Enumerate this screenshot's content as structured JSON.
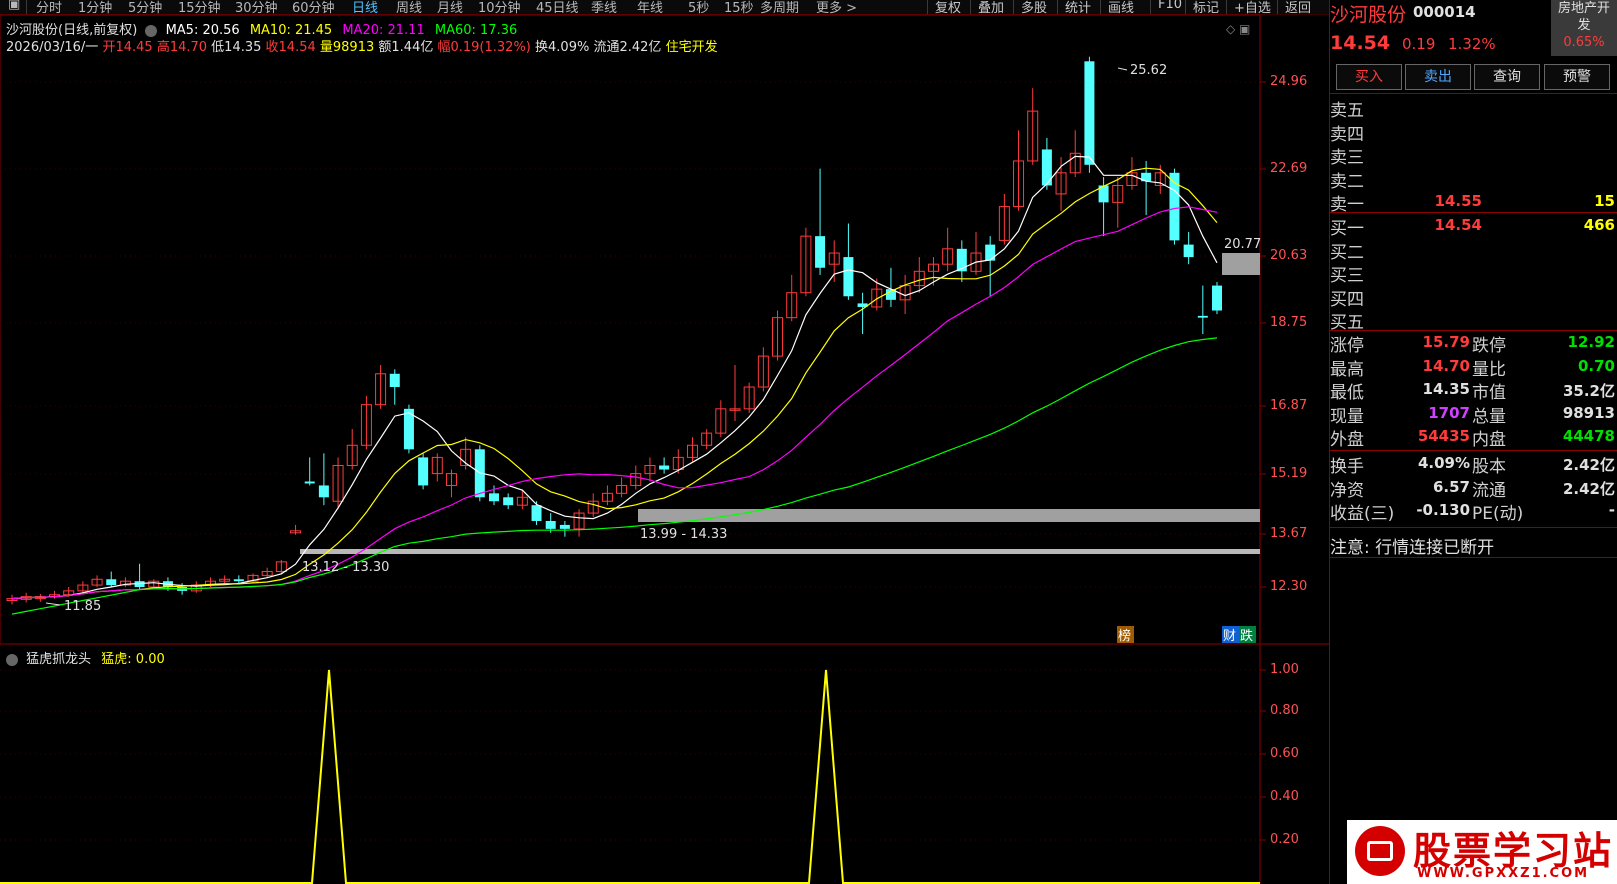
{
  "toolbar": {
    "periods": [
      "分时",
      "1分钟",
      "5分钟",
      "15分钟",
      "30分钟",
      "60分钟",
      "日线",
      "周线",
      "月线",
      "10分钟",
      "45日线",
      "季线",
      "年线",
      "5秒",
      "15秒",
      "多周期",
      "更多 >"
    ],
    "active_period": "日线",
    "right_buttons": [
      "复权",
      "叠加",
      "多股",
      "统计",
      "画线",
      "F10",
      "标记",
      "+自选",
      "返回"
    ]
  },
  "chart_header": {
    "stock": "沙河股份(日线,前复权)",
    "ma5": "MA5: 20.56",
    "ma10": "MA10: 21.45",
    "ma20": "MA20: 21.11",
    "ma60": "MA60: 17.36",
    "date": "2026/03/16/一",
    "open": "开14.45",
    "high": "高14.70",
    "low": "低14.35",
    "close": "收14.54",
    "volume": "量98913",
    "amount": "额1.44亿",
    "change": "幅0.19(1.32%)",
    "turnover": "换4.09%",
    "float": "流通2.42亿",
    "sector": "住宅开发"
  },
  "price_axis": [
    "24.96",
    "22.69",
    "20.63",
    "18.75",
    "16.87",
    "15.19",
    "13.67",
    "12.30"
  ],
  "annotations": {
    "high_label": "25.62",
    "low_label": "11.85",
    "box_label_1": "13.12 - 13.30",
    "box_label_2": "13.99 - 14.33",
    "ma_label": "20.77",
    "tag_bang": "榜",
    "tag_cai": "财",
    "tag_die": "跌"
  },
  "indicator": {
    "name": "猛虎抓龙头",
    "line_label": "猛虎: 0.00",
    "axis": [
      "1.00",
      "0.80",
      "0.60",
      "0.40",
      "0.20"
    ]
  },
  "right_panel": {
    "name": "沙河股份",
    "code": "000014",
    "sector_badge_1": "房地产开",
    "sector_badge_2": "发",
    "sector_pct": "0.65%",
    "price": "14.54",
    "chg": "0.19",
    "chg_pct": "1.32%",
    "buttons": [
      "买入",
      "卖出",
      "查询",
      "预警"
    ],
    "asks": [
      {
        "label": "卖五",
        "price": "",
        "vol": ""
      },
      {
        "label": "卖四",
        "price": "",
        "vol": ""
      },
      {
        "label": "卖三",
        "price": "",
        "vol": ""
      },
      {
        "label": "卖二",
        "price": "",
        "vol": ""
      },
      {
        "label": "卖一",
        "price": "14.55",
        "vol": "15"
      }
    ],
    "bids": [
      {
        "label": "买一",
        "price": "14.54",
        "vol": "466"
      },
      {
        "label": "买二",
        "price": "",
        "vol": ""
      },
      {
        "label": "买三",
        "price": "",
        "vol": ""
      },
      {
        "label": "买四",
        "price": "",
        "vol": ""
      },
      {
        "label": "买五",
        "price": "",
        "vol": ""
      }
    ],
    "stats": [
      {
        "l1": "涨停",
        "v1": "15.79",
        "c1": "#ff3b3b",
        "l2": "跌停",
        "v2": "12.92",
        "c2": "#00e000"
      },
      {
        "l1": "最高",
        "v1": "14.70",
        "c1": "#ff3b3b",
        "l2": "量比",
        "v2": "0.70",
        "c2": "#00e000"
      },
      {
        "l1": "最低",
        "v1": "14.35",
        "c1": "#e0e0e0",
        "l2": "市值",
        "v2": "35.2亿",
        "c2": "#e0e0e0"
      },
      {
        "l1": "现量",
        "v1": "1707",
        "c1": "#d040ff",
        "l2": "总量",
        "v2": "98913",
        "c2": "#e0e0e0"
      },
      {
        "l1": "外盘",
        "v1": "54435",
        "c1": "#ff3b3b",
        "l2": "内盘",
        "v2": "44478",
        "c2": "#00e000"
      }
    ],
    "stats2": [
      {
        "l1": "换手",
        "v1": "4.09%",
        "l2": "股本",
        "v2": "2.42亿"
      },
      {
        "l1": "净资",
        "v1": "6.57",
        "l2": "流通",
        "v2": "2.42亿"
      },
      {
        "l1": "收益(三)",
        "v1": "-0.130",
        "l2": "PE(动)",
        "v2": "-"
      }
    ],
    "notice": "注意: 行情连接已断开"
  },
  "watermark": {
    "cn": "股票学习站",
    "url": "WWW.GPXXZ1.COM"
  },
  "colors": {
    "up": "#ff3b3b",
    "down": "#54ffff",
    "ma5": "#ffffff",
    "ma10": "#ffff00",
    "ma20": "#ff00ff",
    "ma60": "#00ff00",
    "indicator": "#ffff00"
  }
}
